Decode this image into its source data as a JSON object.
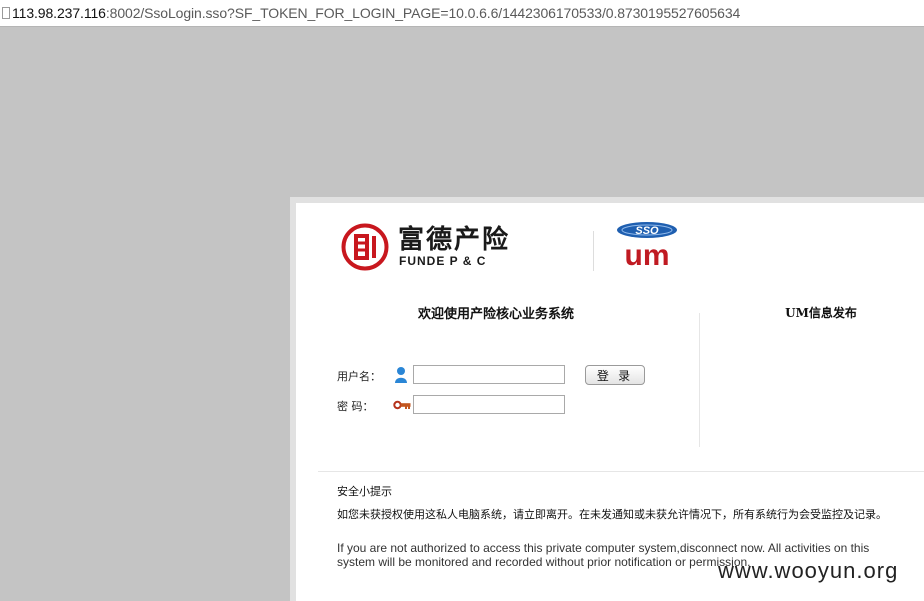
{
  "address_bar": {
    "url_host": "113.98.237.116",
    "url_rest": ":8002/SsoLogin.sso?SF_TOKEN_FOR_LOGIN_PAGE=10.0.6.6/1442306170533/0.8730195527605634"
  },
  "header": {
    "brand_cn": "富德产险",
    "brand_en": "FUNDE P & C",
    "sso_logo_top": "SSO",
    "sso_logo_bottom": "um"
  },
  "login": {
    "welcome": "欢迎使用产险核心业务系统",
    "username_label": "用户名：",
    "password_label": "密  码：",
    "username_value": "",
    "password_value": "",
    "login_button": "登 录"
  },
  "sidebar": {
    "title": "UM信息发布"
  },
  "security_tip": {
    "title": "安全小提示",
    "text_cn": "如您未获授权使用这私人电脑系统，请立即离开。在未发通知或未获允许情况下，所有系统行为会受监控及记录。",
    "text_en": "If you are not authorized to access this private computer system,disconnect now. All activities on this system will be monitored and recorded without prior notification or permission."
  },
  "watermark": "www.wooyun.org",
  "colors": {
    "brand_red": "#c8171e",
    "sso_blue": "#1f5fb0",
    "um_red": "#c01a22",
    "background": "#c4c4c4"
  }
}
